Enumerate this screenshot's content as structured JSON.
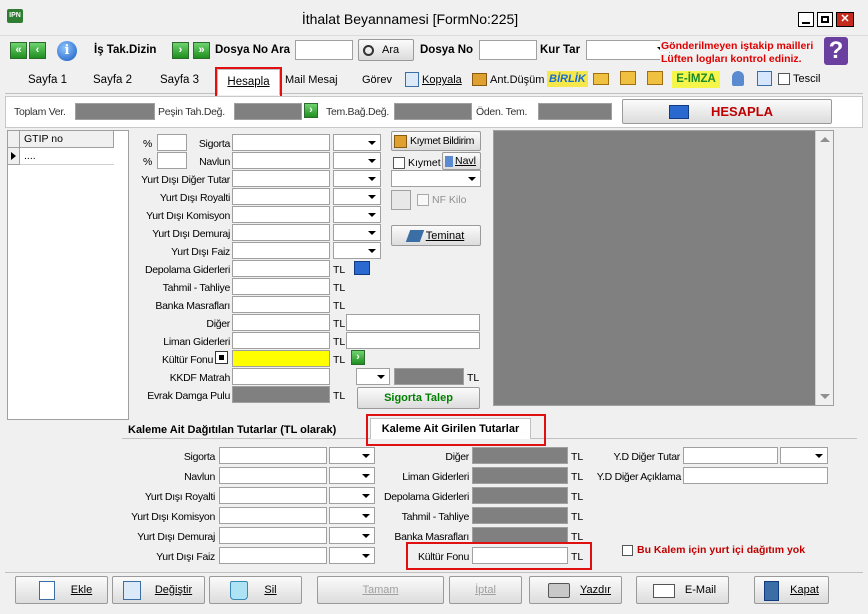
{
  "window": {
    "title": "İthalat Beyannamesi [FormNo:225]",
    "warning_line1": "Gönderilmeyen iştakip mailleri",
    "warning_line2": "Lüften logları kontrol ediniz.",
    "help_glyph": "?"
  },
  "nav": {
    "is_tak_dizin": "İş Tak.Dizin",
    "dosya_no_ara": "Dosya No Ara",
    "ara": "Ara",
    "dosya_no": "Dosya No",
    "kur_tar": "Kur Tar",
    "dosya_no_ara_value": "",
    "dosya_no_value": "",
    "kur_tar_value": ""
  },
  "tabs": {
    "sayfa1": "Sayfa 1",
    "sayfa2": "Sayfa 2",
    "sayfa3": "Sayfa 3",
    "hesapla": "Hesapla",
    "mail": "Mail Mesaj",
    "gorev": "Görev",
    "kopyala": "Kopyala",
    "ant": "Ant.Düşüm",
    "birlik": "BİRLİK",
    "eimza": "E-İMZA",
    "tescil": "Tescil"
  },
  "totals": {
    "toplam": "Toplam Ver.",
    "pesin": "Peşin Tah.Değ.",
    "tem": "Tem.Bağ.Değ.",
    "oden": "Öden. Tem.",
    "hesapla_btn": "HESAPLA"
  },
  "grid": {
    "header": "GTIP no",
    "row1": "...."
  },
  "form": {
    "pct1": "%",
    "pct2": "%",
    "sigorta": "Sigorta",
    "navlun": "Navlun",
    "ydd": "Yurt Dışı Diğer Tutar",
    "ydr": "Yurt Dışı Royalti",
    "ydk": "Yurt Dışı Komisyon",
    "yddm": "Yurt Dışı Demuraj",
    "ydf": "Yurt Dışı Faiz",
    "depo": "Depolama Giderleri",
    "tahmil": "Tahmil - Tahliye",
    "banka": "Banka Masrafları",
    "diger": "Diğer",
    "liman": "Liman Giderleri",
    "kultur": "Kültür Fonu",
    "kkdf": "KKDF Matrah",
    "damga": "Evrak Damga Pulu",
    "tl": "TL",
    "kiymet_bildirim": "Kıymet Bildirim",
    "kiymet": "Kıymet",
    "navl": "Navl",
    "nf_kilo": "NF Kilo",
    "teminat": "Teminat",
    "sigorta_talep": "Sigorta Talep"
  },
  "lower_tabs": {
    "dagitilan": "Kaleme Ait Dağıtılan Tutarlar (TL olarak)",
    "girilen": "Kaleme Ait Girilen Tutarlar"
  },
  "lower": {
    "sigorta": "Sigorta",
    "navlun": "Navlun",
    "ydr": "Yurt Dışı Royalti",
    "ydk": "Yurt Dışı Komisyon",
    "yddm": "Yurt Dışı Demuraj",
    "ydf": "Yurt Dışı Faiz",
    "diger": "Diğer",
    "liman": "Liman Giderleri",
    "depo": "Depolama Giderleri",
    "tahmil": "Tahmil - Tahliye",
    "banka": "Banka Masrafları",
    "kultur": "Kültür Fonu",
    "tl": "TL",
    "yd_diger_tutar": "Y.D Diğer Tutar",
    "yd_diger_aciklama": "Y.D Diğer Açıklama",
    "yurt_ici": "Bu Kalem için yurt içi dağıtım yok"
  },
  "buttons": {
    "ekle": "Ekle",
    "degistir": "Değiştir",
    "sil": "Sil",
    "tamam": "Tamam",
    "iptal": "İptal",
    "yazdir": "Yazdır",
    "email": "E-Mail",
    "kapat": "Kapat"
  },
  "colors": {
    "title_bar": "#f0f0f0",
    "warning": "#e00000",
    "hesapla_text": "#c00000",
    "yellow": "#ffff00",
    "gray_field": "#808080",
    "green": "#008000"
  }
}
